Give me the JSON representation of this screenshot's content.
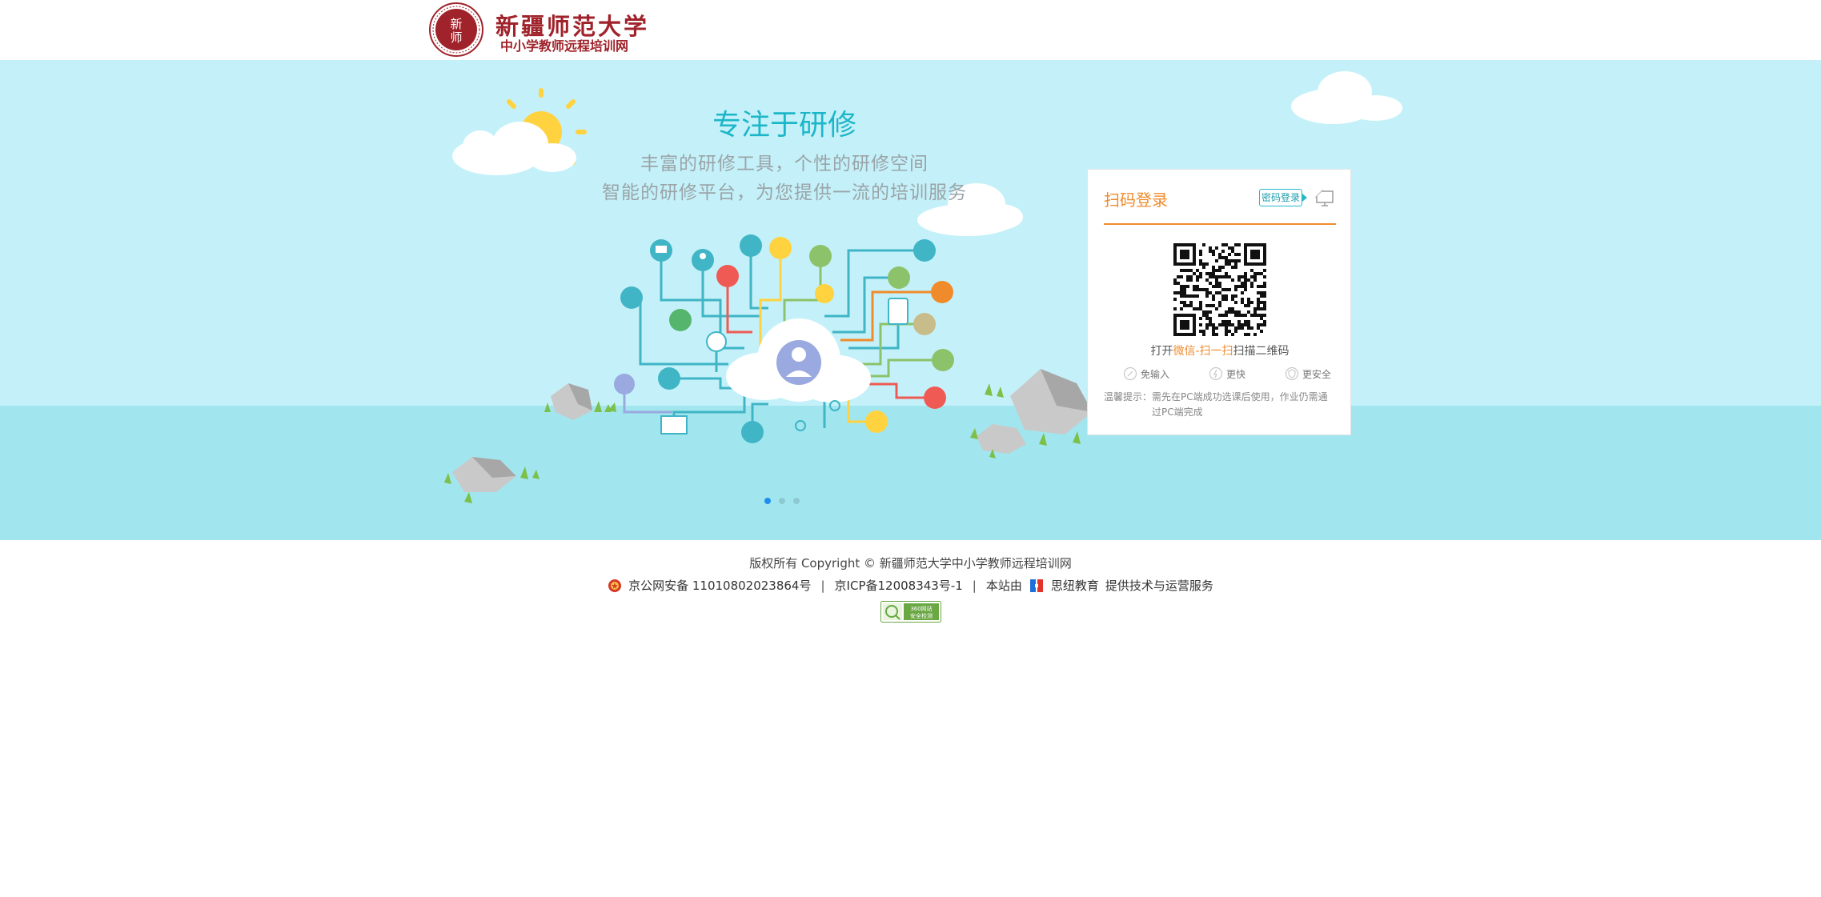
{
  "header": {
    "logo_seal_text": "新师",
    "logo_name": "新疆师范大学",
    "logo_sub": "中小学教师远程培训网"
  },
  "banner": {
    "title": "专注于研修",
    "line1": "丰富的研修工具，个性的研修空间",
    "line2": "智能的研修平台，为您提供一流的培训服务",
    "slides": [
      {
        "active": true
      },
      {
        "active": false
      },
      {
        "active": false
      }
    ],
    "colors": {
      "sky": "#c4f1f9",
      "sea": "#a1e6ee",
      "accent": "#1cb6c8"
    }
  },
  "login": {
    "title": "扫码登录",
    "password_login_label": "密码登录",
    "pc_icon": "monitor-icon",
    "scan_prefix": "打开",
    "scan_highlight": "微信-扫一扫",
    "scan_suffix": "扫描二维码",
    "features": [
      {
        "icon": "no-input-icon",
        "label": "免输入"
      },
      {
        "icon": "faster-icon",
        "label": "更快"
      },
      {
        "icon": "shield-icon",
        "label": "更安全"
      }
    ],
    "tip_label": "温馨提示：",
    "tip_text": "需先在PC端成功选课后使用，作业仍需通过PC端完成",
    "accent_color": "#f08b2c"
  },
  "footer": {
    "copyright": "版权所有 Copyright © 新疆师范大学中小学教师远程培训网",
    "police_record": "京公网安备 11010802023864号",
    "icp_record": "京ICP备12008343号-1",
    "site_by": "本站由",
    "provider": "思纽教育",
    "service": "提供技术与运营服务",
    "badge_text_1": "360网站",
    "badge_text_2": "安全检测"
  }
}
